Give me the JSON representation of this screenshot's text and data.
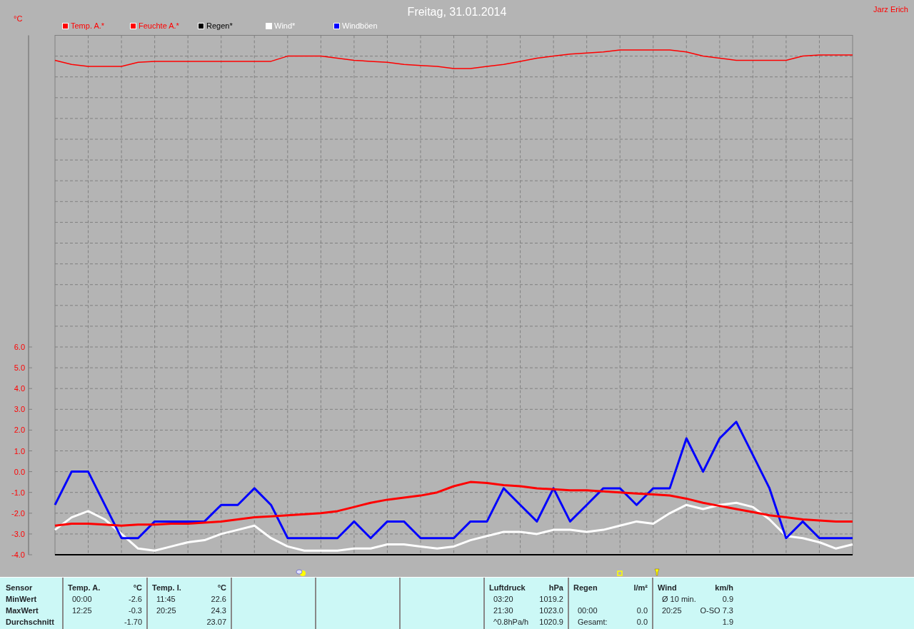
{
  "header": {
    "title": "Freitag, 31.01.2014",
    "author": "Jarz Erich",
    "y_unit": "°C"
  },
  "chart": {
    "chart_data": {
      "type": "line",
      "grid": true,
      "ylim": [
        -4,
        21
      ],
      "yticks": [
        {
          "value": -4,
          "label": "-4.0"
        },
        {
          "value": -3,
          "label": "-3.0"
        },
        {
          "value": -2,
          "label": "-2.0"
        },
        {
          "value": -1,
          "label": "-1.0"
        },
        {
          "value": 0,
          "label": "0.0"
        },
        {
          "value": 1,
          "label": "1.0"
        },
        {
          "value": 2,
          "label": "2.0"
        },
        {
          "value": 3,
          "label": "3.0"
        },
        {
          "value": 4,
          "label": "4.0"
        },
        {
          "value": 5,
          "label": "5.0"
        },
        {
          "value": 6,
          "label": "6.0"
        }
      ],
      "categories": [
        null,
        null,
        null,
        null,
        null,
        null,
        null,
        null,
        null,
        null,
        null,
        null,
        null,
        null,
        null,
        null,
        null,
        null,
        null,
        null,
        null,
        null,
        null,
        null,
        null,
        null,
        null,
        null,
        null,
        null,
        null,
        null,
        null,
        null,
        null,
        null,
        null,
        null,
        null,
        null,
        null,
        null,
        null,
        null,
        null,
        null,
        null,
        null,
        null
      ],
      "series": [
        {
          "name": "Temp. A.*",
          "color": "#ff0000",
          "values": [
            -2.6,
            -2.5,
            -2.5,
            -2.55,
            -2.6,
            -2.55,
            -2.55,
            -2.5,
            -2.5,
            -2.45,
            -2.4,
            -2.3,
            -2.2,
            -2.15,
            -2.1,
            -2.05,
            -2.0,
            -1.9,
            -1.7,
            -1.5,
            -1.35,
            -1.25,
            -1.15,
            -1.0,
            -0.7,
            -0.5,
            -0.55,
            -0.65,
            -0.7,
            -0.8,
            -0.85,
            -0.9,
            -0.9,
            -0.95,
            -1.0,
            -1.05,
            -1.1,
            -1.15,
            -1.3,
            -1.5,
            -1.65,
            -1.8,
            -1.95,
            -2.1,
            -2.2,
            -2.3,
            -2.35,
            -2.4,
            -2.4
          ]
        },
        {
          "name": "Feuchte A.*",
          "color": "#ff0000",
          "values": [
            19.8,
            19.6,
            19.5,
            19.5,
            19.5,
            19.7,
            19.75,
            19.75,
            19.75,
            19.75,
            19.75,
            19.75,
            19.75,
            19.75,
            20.0,
            20.0,
            20.0,
            19.9,
            19.8,
            19.75,
            19.7,
            19.6,
            19.55,
            19.5,
            19.4,
            19.4,
            19.5,
            19.6,
            19.75,
            19.9,
            20.0,
            20.1,
            20.15,
            20.2,
            20.3,
            20.3,
            20.3,
            20.3,
            20.2,
            20.0,
            19.9,
            19.8,
            19.8,
            19.8,
            19.8,
            20.0,
            20.05,
            20.05,
            20.05
          ]
        },
        {
          "name": "Regen*",
          "color": "#000000",
          "values": [
            null,
            null,
            null,
            null,
            null,
            null,
            null,
            null,
            null,
            null,
            null,
            null,
            null,
            null,
            null,
            null,
            null,
            null,
            null,
            null,
            null,
            null,
            null,
            null,
            null,
            null,
            null,
            null,
            null,
            null,
            null,
            null,
            null,
            null,
            null,
            null,
            null,
            null,
            null,
            null,
            null,
            null,
            null,
            null,
            null,
            null,
            null,
            null,
            null
          ]
        },
        {
          "name": "Wind*",
          "color": "#ffffff",
          "values": [
            -2.8,
            -2.2,
            -1.9,
            -2.3,
            -3.0,
            -3.7,
            -3.8,
            -3.6,
            -3.4,
            -3.3,
            -3.0,
            -2.8,
            -2.6,
            -3.2,
            -3.6,
            -3.8,
            -3.8,
            -3.8,
            -3.7,
            -3.7,
            -3.5,
            -3.5,
            -3.6,
            -3.7,
            -3.6,
            -3.3,
            -3.1,
            -2.9,
            -2.9,
            -3.0,
            -2.8,
            -2.8,
            -2.9,
            -2.8,
            -2.6,
            -2.4,
            -2.5,
            -2.0,
            -1.6,
            -1.8,
            -1.6,
            -1.5,
            -1.7,
            -2.3,
            -3.1,
            -3.2,
            -3.4,
            -3.7,
            -3.5
          ]
        },
        {
          "name": "Windböen",
          "color": "#0000ff",
          "values": [
            -1.6,
            0,
            0,
            -1.6,
            -3.2,
            -3.2,
            -2.4,
            -2.4,
            -2.4,
            -2.4,
            -1.6,
            -1.6,
            -0.8,
            -1.6,
            -3.2,
            -3.2,
            -3.2,
            -3.2,
            -2.4,
            -3.2,
            -2.4,
            -2.4,
            -3.2,
            -3.2,
            -3.2,
            -2.4,
            -2.4,
            -0.8,
            -1.6,
            -2.4,
            -0.8,
            -2.4,
            -1.6,
            -0.8,
            -0.8,
            -1.6,
            -0.8,
            -0.8,
            1.6,
            0,
            1.6,
            2.4,
            0.8,
            -0.8,
            -3.2,
            -2.4,
            -3.2,
            -3.2,
            -3.2
          ]
        }
      ]
    }
  },
  "markers": [
    {
      "kind": "weather"
    },
    {
      "kind": "square"
    },
    {
      "kind": "pointer"
    }
  ],
  "stats": {
    "row_labels": [
      "Sensor",
      "MinWert",
      "MaxWert",
      "Durchschnitt"
    ],
    "blocks": [
      {
        "kind": "data",
        "header": [
          "Temp. A.",
          "°C"
        ],
        "rows": [
          {
            "time": "00:00",
            "value": "-2.6"
          },
          {
            "time": "12:25",
            "value": "-0.3"
          },
          {
            "value": "-1.70"
          }
        ]
      },
      {
        "kind": "data",
        "header": [
          "Temp. I.",
          "°C"
        ],
        "rows": [
          {
            "time": "11:45",
            "value": "22.6"
          },
          {
            "time": "20:25",
            "value": "24.3"
          },
          {
            "value": "23.07"
          }
        ]
      },
      {
        "kind": "blank"
      },
      {
        "kind": "blank"
      },
      {
        "kind": "blank"
      },
      {
        "kind": "data",
        "header": [
          "Luftdruck",
          "hPa"
        ],
        "rows": [
          {
            "time": "03:20",
            "value": "1019.2"
          },
          {
            "time": "21:30",
            "value": "1023.0"
          },
          {
            "time": "^0.8hPa/h",
            "value": "1020.9"
          }
        ]
      },
      {
        "kind": "data",
        "header": [
          "Regen",
          "l/m²"
        ],
        "rows": [
          {},
          {
            "time": "00:00",
            "value": "0.0"
          },
          {
            "time": "Gesamt:",
            "value": "0.0"
          }
        ]
      },
      {
        "kind": "data",
        "header": [
          "Wind",
          "km/h"
        ],
        "rows": [
          {
            "time": "Ø 10 min.",
            "value": "0.9"
          },
          {
            "time": "20:25",
            "value": "O-SO 7.3"
          },
          {
            "value": "1.9"
          }
        ]
      }
    ]
  }
}
